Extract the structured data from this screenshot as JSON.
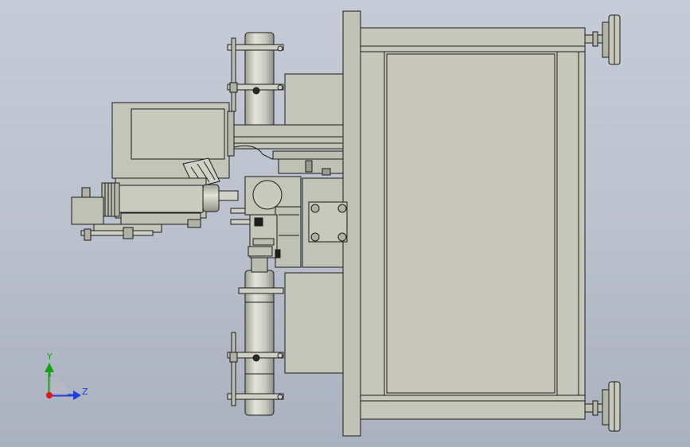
{
  "triad": {
    "y_label": "Y",
    "z_label": "Z",
    "colors": {
      "y": "#14a114",
      "z": "#1f3fd6",
      "x": "#d61a1a"
    }
  },
  "model": {
    "colors": {
      "metal_light": "#c9cabf",
      "metal": "#bdbeb2",
      "metal_dark": "#a8a99d",
      "cylinder": "#d2d3c8",
      "edge": "#1c1c1c"
    }
  }
}
